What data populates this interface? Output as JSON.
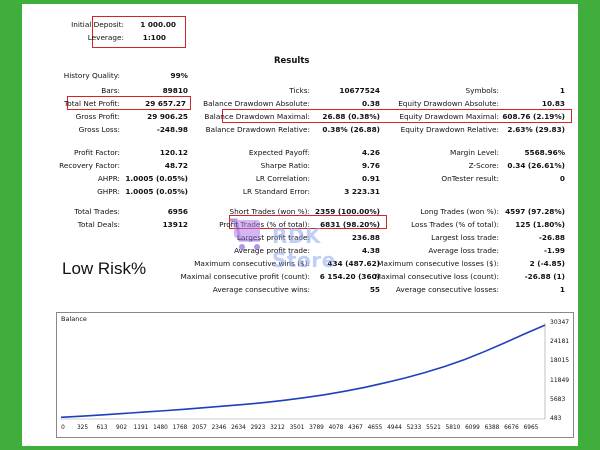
{
  "header": {
    "initial_deposit_label": "Initial Deposit:",
    "initial_deposit_value": "1 000.00",
    "leverage_label": "Leverage:",
    "leverage_value": "1:100"
  },
  "results_title": "Results",
  "stats": {
    "history_quality_label": "History Quality:",
    "history_quality_value": "99%",
    "bars_label": "Bars:",
    "bars_value": "89810",
    "ticks_label": "Ticks:",
    "ticks_value": "10677524",
    "symbols_label": "Symbols:",
    "symbols_value": "1",
    "total_net_profit_label": "Total Net Profit:",
    "total_net_profit_value": "29 657.27",
    "balance_dd_abs_label": "Balance Drawdown Absolute:",
    "balance_dd_abs_value": "0.38",
    "equity_dd_abs_label": "Equity Drawdown Absolute:",
    "equity_dd_abs_value": "10.83",
    "gross_profit_label": "Gross Profit:",
    "gross_profit_value": "29 906.25",
    "balance_dd_max_label": "Balance Drawdown Maximal:",
    "balance_dd_max_value": "26.88 (0.38%)",
    "equity_dd_max_label": "Equity Drawdown Maximal:",
    "equity_dd_max_value": "608.76 (2.19%)",
    "gross_loss_label": "Gross Loss:",
    "gross_loss_value": "-248.98",
    "balance_dd_rel_label": "Balance Drawdown Relative:",
    "balance_dd_rel_value": "0.38% (26.88)",
    "equity_dd_rel_label": "Equity Drawdown Relative:",
    "equity_dd_rel_value": "2.63% (29.83)",
    "profit_factor_label": "Profit Factor:",
    "profit_factor_value": "120.12",
    "expected_payoff_label": "Expected Payoff:",
    "expected_payoff_value": "4.26",
    "margin_level_label": "Margin Level:",
    "margin_level_value": "5568.96%",
    "recovery_factor_label": "Recovery Factor:",
    "recovery_factor_value": "48.72",
    "sharpe_ratio_label": "Sharpe Ratio:",
    "sharpe_ratio_value": "9.76",
    "z_score_label": "Z-Score:",
    "z_score_value": "0.34 (26.61%)",
    "ahpr_label": "AHPR:",
    "ahpr_value": "1.0005 (0.05%)",
    "lr_correlation_label": "LR Correlation:",
    "lr_correlation_value": "0.91",
    "ontester_label": "OnTester result:",
    "ontester_value": "0",
    "ghpr_label": "GHPR:",
    "ghpr_value": "1.0005 (0.05%)",
    "lr_std_error_label": "LR Standard Error:",
    "lr_std_error_value": "3 223.31",
    "total_trades_label": "Total Trades:",
    "total_trades_value": "6956",
    "short_trades_label": "Short Trades (won %):",
    "short_trades_value": "2359 (100.00%)",
    "long_trades_label": "Long Trades (won %):",
    "long_trades_value": "4597 (97.28%)",
    "total_deals_label": "Total Deals:",
    "total_deals_value": "13912",
    "profit_trades_label": "Profit Trades (% of total):",
    "profit_trades_value": "6831 (98.20%)",
    "loss_trades_label": "Loss Trades (% of total):",
    "loss_trades_value": "125 (1.80%)",
    "largest_profit_label": "Largest profit trade:",
    "largest_profit_value": "236.88",
    "largest_loss_label": "Largest loss trade:",
    "largest_loss_value": "-26.88",
    "avg_profit_label": "Average profit trade:",
    "avg_profit_value": "4.38",
    "avg_loss_label": "Average loss trade:",
    "avg_loss_value": "-1.99",
    "max_consec_wins_label": "Maximum consecutive wins ($):",
    "max_consec_wins_value": "434 (487.62)",
    "max_consec_losses_label": "Maximum consecutive losses ($):",
    "max_consec_losses_value": "2 (-4.85)",
    "maximal_consec_profit_label": "Maximal consecutive profit (count):",
    "maximal_consec_profit_value": "6 154.20 (360)",
    "maximal_consec_loss_label": "Maximal consecutive loss (count):",
    "maximal_consec_loss_value": "-26.88 (1)",
    "avg_consec_wins_label": "Average consecutive wins:",
    "avg_consec_wins_value": "55",
    "avg_consec_losses_label": "Average consecutive losses:",
    "avg_consec_losses_value": "1"
  },
  "watermark_text": "RDK Store",
  "annotation": "Low Risk%",
  "colors": {
    "background": "#3fae3c",
    "highlight": "#d42626",
    "line": "#1f3fbf"
  },
  "chart_data": {
    "type": "line",
    "title": "Balance",
    "xlabel": "",
    "ylabel": "",
    "x_ticks": [
      "0",
      "325",
      "613",
      "902",
      "1191",
      "1480",
      "1768",
      "2057",
      "2346",
      "2634",
      "2923",
      "3212",
      "3501",
      "3789",
      "4078",
      "4367",
      "4655",
      "4944",
      "5233",
      "5521",
      "5810",
      "6099",
      "6388",
      "6676",
      "6965"
    ],
    "y_ticks": [
      "30347",
      "24181",
      "18015",
      "11849",
      "5683",
      "483"
    ],
    "xlim": [
      0,
      6965
    ],
    "ylim": [
      483,
      30347
    ],
    "series": [
      {
        "x": [
          0,
          325,
          613,
          902,
          1191,
          1480,
          1768,
          2057,
          2346,
          2634,
          2923,
          3212,
          3501,
          3789,
          4078,
          4367,
          4655,
          4944,
          5233,
          5521,
          5810,
          6099,
          6388,
          6676,
          6965
        ],
        "values": [
          1000,
          1400,
          1800,
          2200,
          2650,
          3050,
          3500,
          4000,
          4500,
          5000,
          5600,
          6300,
          7100,
          8000,
          9100,
          10300,
          11700,
          13200,
          14900,
          16800,
          19000,
          21500,
          24200,
          27000,
          29700
        ]
      }
    ]
  }
}
